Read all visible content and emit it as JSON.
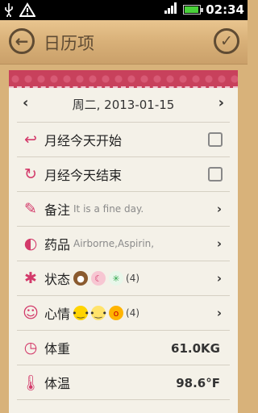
{
  "status": {
    "time": "02:34"
  },
  "header": {
    "title": "日历项"
  },
  "date": {
    "text": "周二, 2013-01-15"
  },
  "rows": [
    {
      "label": "月经今天开始"
    },
    {
      "label": "月经今天结束"
    },
    {
      "label": "备注",
      "note": "It is a fine day."
    },
    {
      "label": "药品",
      "note": "Airborne,Aspirin,"
    },
    {
      "label": "状态",
      "count": "(4)"
    },
    {
      "label": "心情",
      "count": "(4)"
    },
    {
      "label": "体重",
      "value": "61.0KG"
    },
    {
      "label": "体温",
      "value": "98.6°F"
    }
  ],
  "colors": {
    "accent": "#d33a6a",
    "ribbon": "#c8415c",
    "wood": "#d8b27a"
  }
}
